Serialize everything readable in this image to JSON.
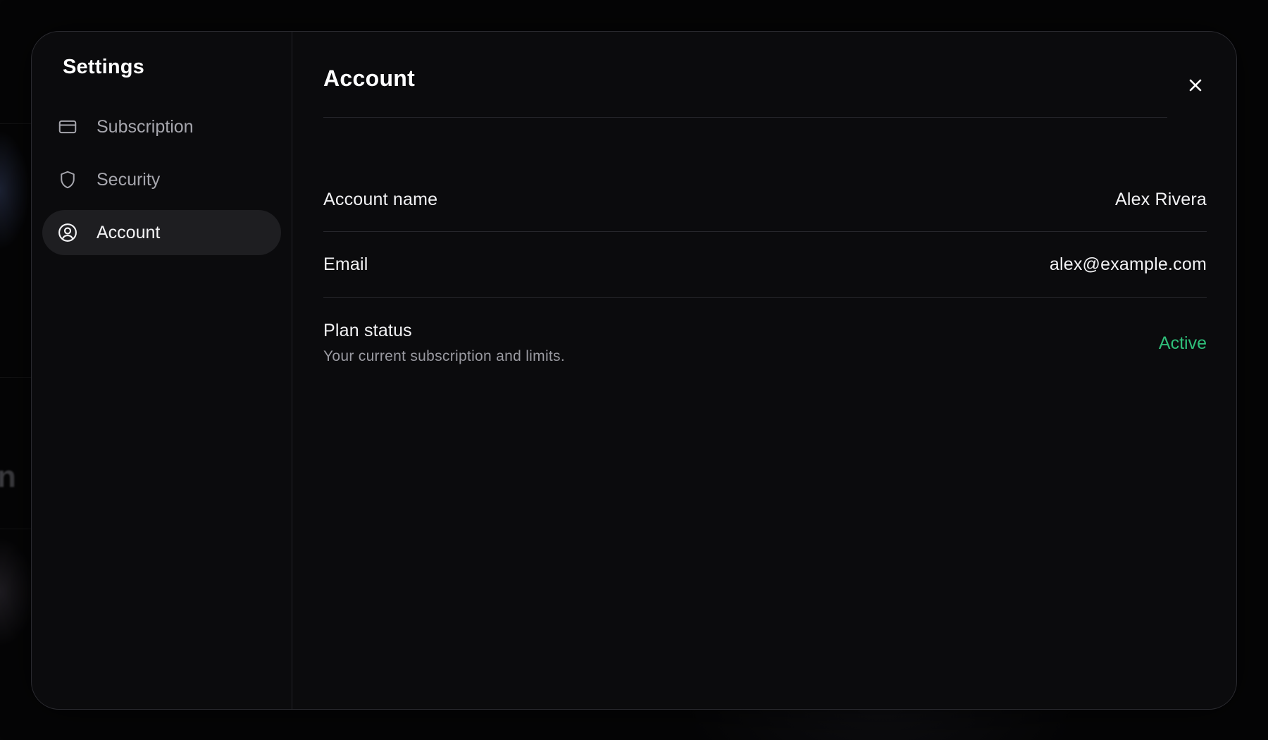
{
  "colors": {
    "background": "#050506",
    "panel": "#0b0b0d",
    "active_nav": "#1e1e21",
    "status_active": "#2fbf7a"
  },
  "backdrop": {
    "glyph": "n"
  },
  "sidebar": {
    "title": "Settings",
    "items": [
      {
        "label": "Subscription",
        "icon": "credit-card-icon",
        "active": false
      },
      {
        "label": "Security",
        "icon": "shield-icon",
        "active": false
      },
      {
        "label": "Account",
        "icon": "user-circle-icon",
        "active": true
      }
    ]
  },
  "main": {
    "title": "Account",
    "close_icon": "close-icon",
    "rows": [
      {
        "label": "Account name",
        "value": "Alex Rivera"
      },
      {
        "label": "Email",
        "value": "alex@example.com"
      },
      {
        "label": "Plan status",
        "description": "Your current subscription and limits.",
        "value": "Active"
      }
    ]
  }
}
